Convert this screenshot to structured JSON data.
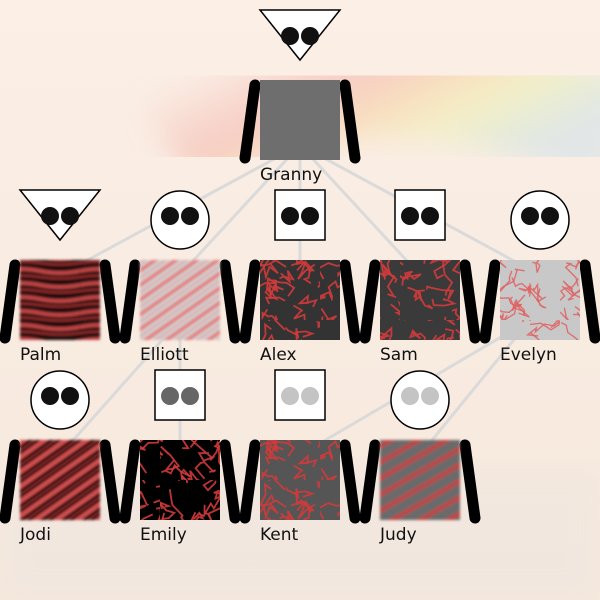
{
  "colors": {
    "background": "#f8ebe0",
    "link": "#dadada",
    "arm": "#000000",
    "head_fill": "#ffffff",
    "eye_dark": "#111111",
    "eye_mid": "#666666",
    "eye_light": "#c4c4c4"
  },
  "people": [
    {
      "id": "granny",
      "name": "Granny",
      "head": "triangle",
      "eyes": "#111111",
      "body": "solid-gray",
      "colors": [
        "#6e6e6e"
      ]
    },
    {
      "id": "palm",
      "name": "Palm",
      "head": "triangle",
      "eyes": "#111111",
      "body": "stripes",
      "colors": [
        "#000000",
        "#d24a4a"
      ]
    },
    {
      "id": "elliott",
      "name": "Elliott",
      "head": "circle",
      "eyes": "#111111",
      "body": "stripes-diagonal",
      "colors": [
        "#c8c8c8",
        "#e07070"
      ]
    },
    {
      "id": "alex",
      "name": "Alex",
      "head": "rect",
      "eyes": "#111111",
      "body": "veins",
      "colors": [
        "#333333",
        "#d23a3a"
      ]
    },
    {
      "id": "sam",
      "name": "Sam",
      "head": "rect",
      "eyes": "#111111",
      "body": "veins",
      "colors": [
        "#3a3a3a",
        "#d23a3a"
      ]
    },
    {
      "id": "evelyn",
      "name": "Evelyn",
      "head": "circle",
      "eyes": "#111111",
      "body": "veins-light",
      "colors": [
        "#c8c8c8",
        "#e06060"
      ]
    },
    {
      "id": "jodi",
      "name": "Jodi",
      "head": "circle",
      "eyes": "#111111",
      "body": "stripes-diagonal",
      "colors": [
        "#000000",
        "#d25050"
      ]
    },
    {
      "id": "emily",
      "name": "Emily",
      "head": "rect",
      "eyes": "#666666",
      "body": "veins",
      "colors": [
        "#000000",
        "#d23a3a"
      ]
    },
    {
      "id": "kent",
      "name": "Kent",
      "head": "rect",
      "eyes": "#c4c4c4",
      "body": "veins",
      "colors": [
        "#555555",
        "#d23a3a"
      ]
    },
    {
      "id": "judy",
      "name": "Judy",
      "head": "circle",
      "eyes": "#c4c4c4",
      "body": "stripes-diagonal",
      "colors": [
        "#6a6a6a",
        "#d04040"
      ]
    }
  ],
  "links": [
    [
      "granny",
      "palm"
    ],
    [
      "granny",
      "elliott"
    ],
    [
      "granny",
      "alex"
    ],
    [
      "granny",
      "sam"
    ],
    [
      "granny",
      "evelyn"
    ],
    [
      "elliott",
      "jodi"
    ],
    [
      "elliott",
      "emily"
    ],
    [
      "evelyn",
      "kent"
    ],
    [
      "evelyn",
      "judy"
    ]
  ]
}
